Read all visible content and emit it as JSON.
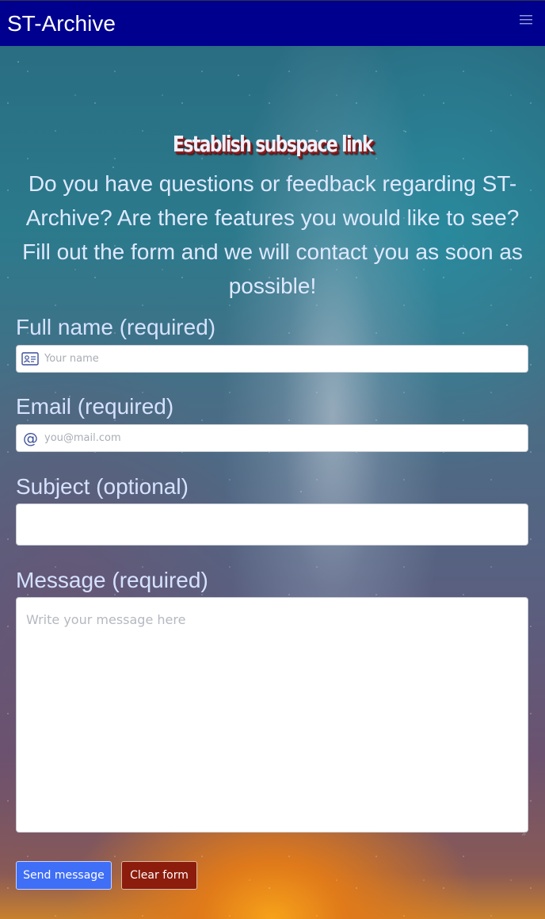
{
  "navbar": {
    "brand": "ST-Archive",
    "menu_icon": "hamburger-menu-icon",
    "background_color": "#00008f"
  },
  "main": {
    "heading": "Establish subspace link",
    "intro": "Do you have questions or feedback regarding ST-Archive? Are there features you would like to see? Fill out the form and we will contact you as soon as possible!"
  },
  "form": {
    "full_name": {
      "label": "Full name (required)",
      "placeholder": "Your name",
      "value": "",
      "icon": "id-card-icon"
    },
    "email": {
      "label": "Email (required)",
      "placeholder": "you@mail.com",
      "value": "",
      "icon": "at-sign-icon"
    },
    "subject": {
      "label": "Subject (optional)",
      "placeholder": "",
      "value": ""
    },
    "message": {
      "label": "Message (required)",
      "placeholder": "Write your message here",
      "value": ""
    },
    "send_label": "Send message",
    "clear_label": "Clear form",
    "send_color": "#3f6ef7",
    "clear_color": "#8c1c0c"
  }
}
